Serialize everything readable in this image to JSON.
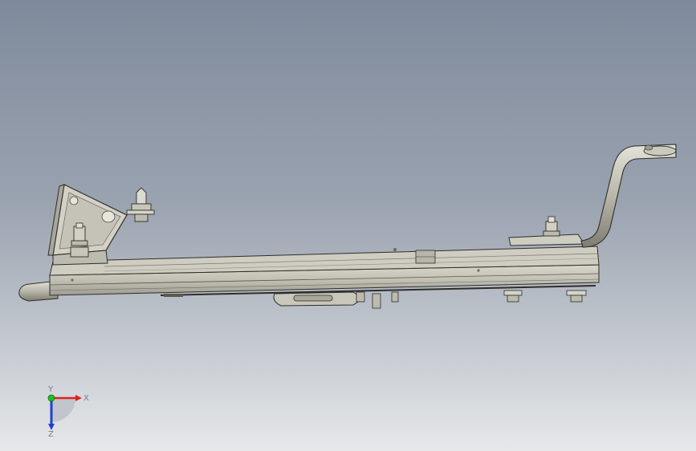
{
  "viewport": {
    "background_top": "#7f8a9c",
    "background_bottom": "#e6e8ea"
  },
  "model": {
    "fill_main": "#c4c2b4",
    "fill_light": "#dcdbd0",
    "fill_dark": "#9e9c90",
    "edge": "#2e2e2a"
  },
  "triad": {
    "x_label": "X",
    "y_label": "Y",
    "z_label": "Z",
    "x_color": "#e02020",
    "y_color": "#20c020",
    "z_color": "#2040d0"
  }
}
